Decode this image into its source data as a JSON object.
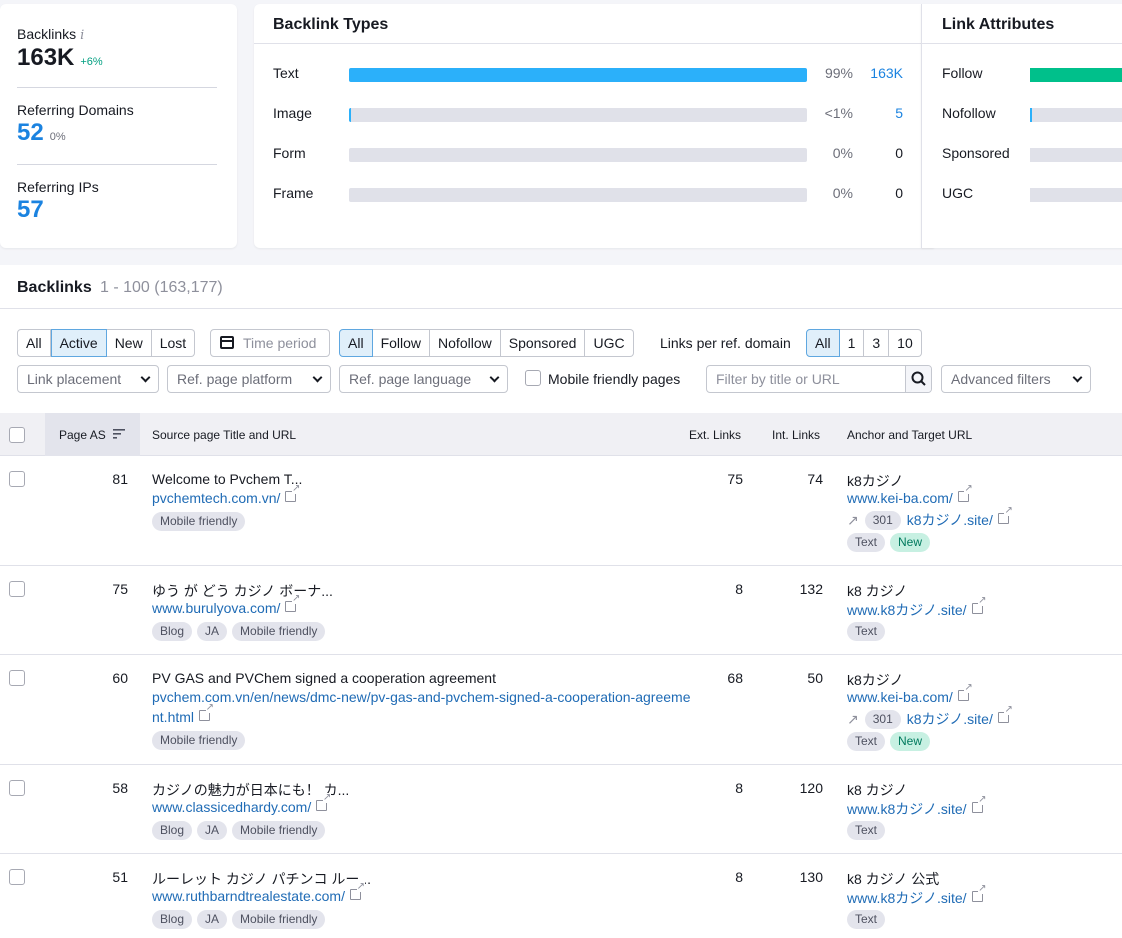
{
  "summary": {
    "backlinks_label": "Backlinks",
    "backlinks_value": "163K",
    "backlinks_change": "+6%",
    "ref_domains_label": "Referring Domains",
    "ref_domains_value": "52",
    "ref_domains_change": "0%",
    "ref_ips_label": "Referring IPs",
    "ref_ips_value": "57"
  },
  "backlink_types": {
    "title": "Backlink Types",
    "rows": [
      {
        "label": "Text",
        "pct": "99%",
        "count": "163K",
        "fill": 1.0
      },
      {
        "label": "Image",
        "pct": "<1%",
        "count": "5",
        "fill": 0.005
      },
      {
        "label": "Form",
        "pct": "0%",
        "count": "0",
        "fill": 0
      },
      {
        "label": "Frame",
        "pct": "0%",
        "count": "0",
        "fill": 0
      }
    ]
  },
  "link_attributes": {
    "title": "Link Attributes",
    "rows": [
      {
        "label": "Follow",
        "fill": 1.0
      },
      {
        "label": "Nofollow",
        "fill": 0.01
      },
      {
        "label": "Sponsored",
        "fill": 0
      },
      {
        "label": "UGC",
        "fill": 0
      }
    ]
  },
  "backlinks": {
    "title": "Backlinks",
    "range": "1 - 100 (163,177)"
  },
  "filters": {
    "status": [
      "All",
      "Active",
      "New",
      "Lost"
    ],
    "time_period": "Time period",
    "link_type": [
      "All",
      "Follow",
      "Nofollow",
      "Sponsored",
      "UGC"
    ],
    "links_per_ref_domain_label": "Links per ref. domain",
    "links_per_ref_domain": [
      "All",
      "1",
      "3",
      "10"
    ],
    "link_placement": "Link placement",
    "ref_page_platform": "Ref. page platform",
    "ref_page_language": "Ref. page language",
    "mobile_friendly_label": "Mobile friendly pages",
    "search_placeholder": "Filter by title or URL",
    "advanced_filters": "Advanced filters"
  },
  "table": {
    "headers": {
      "page_as": "Page AS",
      "source": "Source page Title and URL",
      "ext_links": "Ext. Links",
      "int_links": "Int. Links",
      "anchor": "Anchor and Target URL"
    },
    "rows": [
      {
        "as": "81",
        "title": "Welcome to Pvchem T...",
        "url": "pvchemtech.com.vn/",
        "tags": [
          "Mobile friendly"
        ],
        "ext": "75",
        "int": "74",
        "anchor": "k8カジノ",
        "target": "www.kei-ba.com/",
        "redirect_code": "301",
        "redirect_url": "k8カジノ.site/",
        "anchor_tags": [
          "Text",
          "New"
        ]
      },
      {
        "as": "75",
        "title": "ゆう が どう カジノ ボーナ...",
        "url": "www.burulyova.com/",
        "tags": [
          "Blog",
          "JA",
          "Mobile friendly"
        ],
        "ext": "8",
        "int": "132",
        "anchor": "k8 カジノ",
        "target": "www.k8カジノ.site/",
        "anchor_tags": [
          "Text"
        ]
      },
      {
        "as": "60",
        "title": "PV GAS and PVChem signed a cooperation agreement",
        "url": "pvchem.com.vn/en/news/dmc-new/pv-gas-and-pvchem-signed-a-cooperation-agreement.html",
        "tags": [
          "Mobile friendly"
        ],
        "ext": "68",
        "int": "50",
        "anchor": "k8カジノ",
        "target": "www.kei-ba.com/",
        "redirect_code": "301",
        "redirect_url": "k8カジノ.site/",
        "anchor_tags": [
          "Text",
          "New"
        ]
      },
      {
        "as": "58",
        "title": "カジノの魅力が日本にも！ カ...",
        "url": "www.classicedhardy.com/",
        "tags": [
          "Blog",
          "JA",
          "Mobile friendly"
        ],
        "ext": "8",
        "int": "120",
        "anchor": "k8 カジノ",
        "target": "www.k8カジノ.site/",
        "anchor_tags": [
          "Text"
        ]
      },
      {
        "as": "51",
        "title": "ルーレット カジノ パチンコ ルー...",
        "url": "www.ruthbarndtrealestate.com/",
        "tags": [
          "Blog",
          "JA",
          "Mobile friendly"
        ],
        "ext": "8",
        "int": "130",
        "anchor": "k8 カジノ 公式",
        "target": "www.k8カジノ.site/",
        "anchor_tags": [
          "Text"
        ]
      }
    ]
  }
}
